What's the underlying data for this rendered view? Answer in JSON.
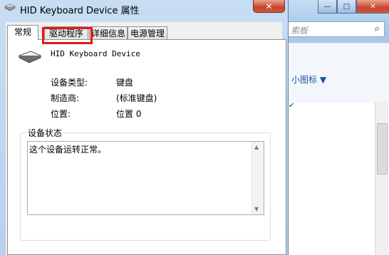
{
  "background_window": {
    "search_placeholder": "索板",
    "search_icon": "magnifier-icon",
    "view_label": "小图标 ▼",
    "caption_buttons": [
      "—",
      "□",
      "✕"
    ]
  },
  "dialog": {
    "title": "HID Keyboard Device 属性",
    "close_label": "✕",
    "tabs": [
      {
        "label": "常规",
        "active": true
      },
      {
        "label": "驱动程序",
        "active": false,
        "highlighted": true
      },
      {
        "label": "详细信息",
        "active": false
      },
      {
        "label": "电源管理",
        "active": false
      }
    ],
    "device_name": "HID Keyboard Device",
    "properties": [
      {
        "label": "设备类型:",
        "value": "键盘"
      },
      {
        "label": "制造商:",
        "value": "(标准键盘)"
      },
      {
        "label": "位置:",
        "value": "位置 0"
      }
    ],
    "status_group_label": "设备状态",
    "status_text": "这个设备运转正常。"
  },
  "colors": {
    "highlight": "#e21a1a",
    "close_button": "#c6452a",
    "link": "#1e4fa0"
  }
}
